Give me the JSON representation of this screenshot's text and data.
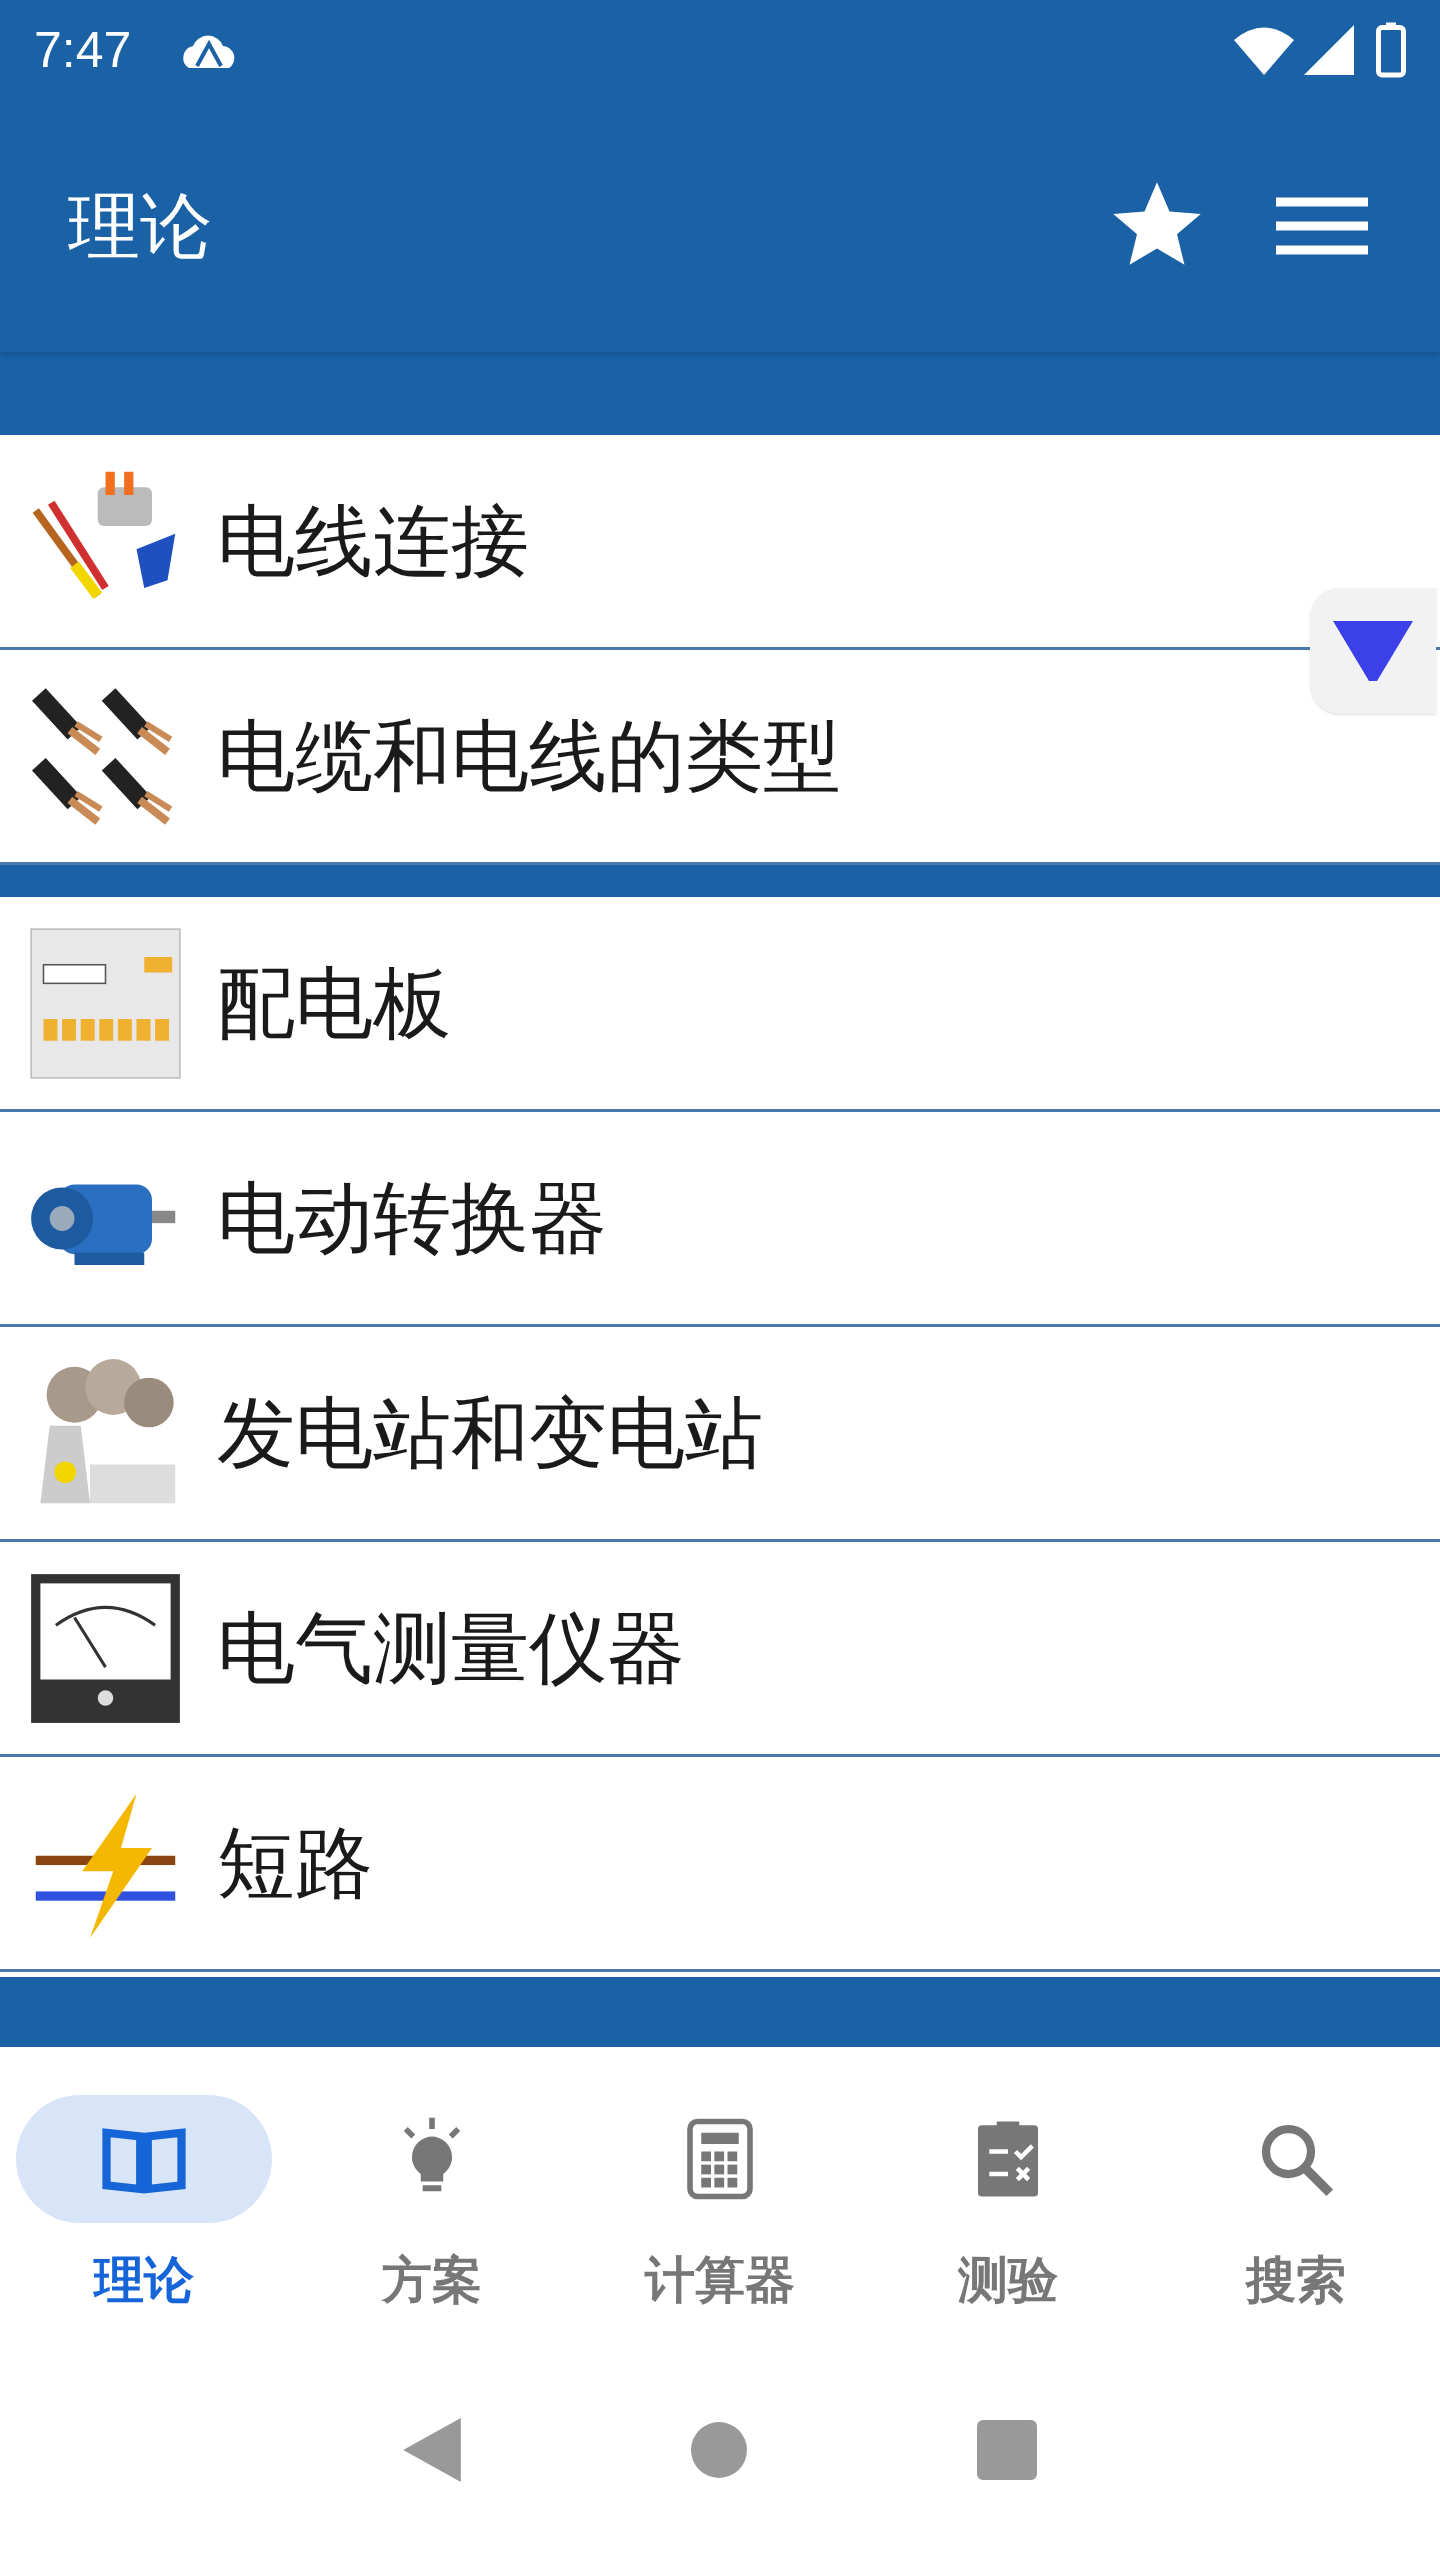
{
  "status_bar": {
    "time": "7:47"
  },
  "app_bar": {
    "title": "理论"
  },
  "sections": [
    {
      "items": [
        {
          "kind": "connector",
          "label": "电线连接"
        },
        {
          "kind": "cable",
          "label": "电缆和电线的类型"
        }
      ]
    },
    {
      "items": [
        {
          "kind": "panel",
          "label": "配电板"
        },
        {
          "kind": "motor",
          "label": "电动转换器"
        },
        {
          "kind": "plant",
          "label": "发电站和变电站"
        },
        {
          "kind": "meter",
          "label": "电气测量仪器"
        },
        {
          "kind": "short",
          "label": "短路"
        }
      ]
    }
  ],
  "bottom_nav": [
    {
      "kind": "book",
      "label": "理论",
      "selected": true
    },
    {
      "kind": "bulb",
      "label": "方案",
      "selected": false
    },
    {
      "kind": "calc",
      "label": "计算器",
      "selected": false
    },
    {
      "kind": "clip",
      "label": "测验",
      "selected": false
    },
    {
      "kind": "search",
      "label": "搜索",
      "selected": false
    }
  ]
}
